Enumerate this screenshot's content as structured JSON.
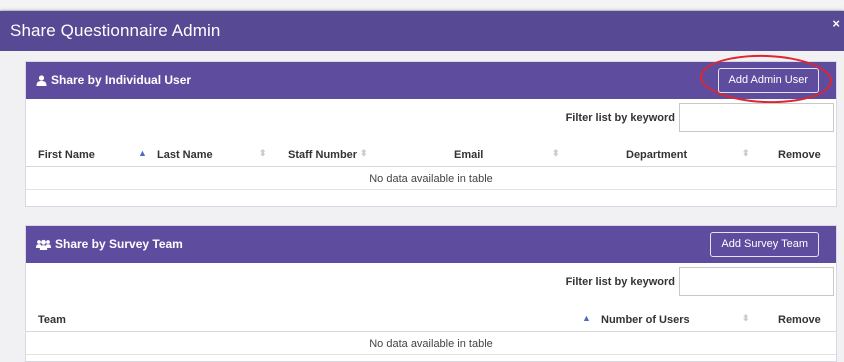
{
  "modal": {
    "title": "Share Questionnaire Admin",
    "close_icon": "×"
  },
  "individual": {
    "title": "Share by Individual User",
    "icon": "user-icon",
    "add_button": "Add Admin User",
    "filter_label": "Filter list by keyword",
    "filter_value": "",
    "columns": [
      "First Name",
      "Last Name",
      "Staff Number",
      "Email",
      "Department",
      "Remove"
    ],
    "empty_message": "No data available in table"
  },
  "team": {
    "title": "Share by Survey Team",
    "icon": "users-icon",
    "add_button": "Add Survey Team",
    "filter_label": "Filter list by keyword",
    "filter_value": "",
    "columns": [
      "Team",
      "Number of Users",
      "Remove"
    ],
    "empty_message": "No data available in table"
  },
  "colors": {
    "header": "#574993",
    "panel_heading": "#5e4d9e",
    "annotation": "#e0252f",
    "sort_active": "#4a6cc9"
  }
}
